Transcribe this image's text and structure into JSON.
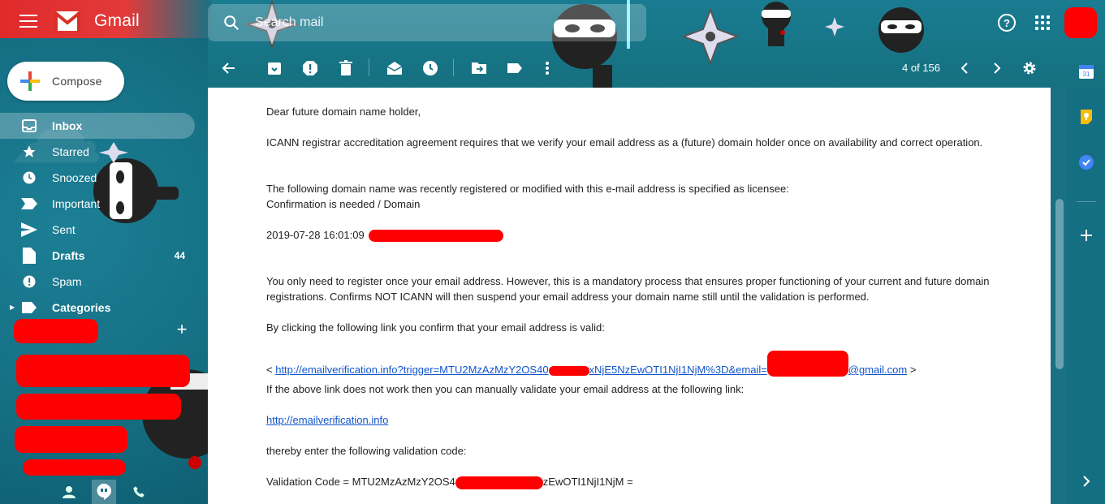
{
  "header": {
    "app_name": "Gmail",
    "search_placeholder": "Search mail"
  },
  "sidebar": {
    "compose_label": "Compose",
    "items": [
      {
        "label": "Inbox",
        "count": "",
        "active": true,
        "bold": true,
        "icon": "inbox-icon"
      },
      {
        "label": "Starred",
        "count": "",
        "icon": "star-icon"
      },
      {
        "label": "Snoozed",
        "count": "",
        "icon": "clock-icon"
      },
      {
        "label": "Important",
        "count": "",
        "icon": "important-icon"
      },
      {
        "label": "Sent",
        "count": "",
        "icon": "send-icon"
      },
      {
        "label": "Drafts",
        "count": "44",
        "bold": true,
        "icon": "draft-icon"
      },
      {
        "label": "Spam",
        "count": "",
        "icon": "spam-icon"
      },
      {
        "label": "Categories",
        "count": "",
        "bold": true,
        "icon": "label-icon"
      }
    ]
  },
  "toolbar": {
    "pager_text": "4 of 156"
  },
  "email": {
    "greeting": "Dear future domain name holder,",
    "p1": "ICANN registrar accreditation agreement requires that we verify your email address as a (future) domain holder once on availability and correct operation.",
    "p2_line1": "The following domain name was recently registered or modified with this e-mail address is specified as licensee:",
    "p2_line2": "Confirmation is needed / Domain",
    "timestamp": "2019-07-28 16:01:09",
    "p3": "You only need to register once your email address. However, this is a mandatory process that ensures proper functioning of your current and future domain registrations. Confirms NOT ICANN will then suspend your email address your domain name still until the validation is performed.",
    "p4": "By clicking the following link you confirm that your email address is valid:",
    "link_prefix": "< ",
    "link_part1": "http://emailverification.info?trigger=MTU2MzAzMzY2OS40",
    "link_part2": "xNjE5NzEwOTI1NjI1NjM%3D&email=",
    "link_part3": "@gmail.com",
    "link_suffix": " >",
    "p5": "If the above link does not work then you can manually validate your email address at the following link:",
    "link2": "http://emailverification.info",
    "p6": "thereby enter the following validation code:",
    "code_prefix": "Validation Code = MTU2MzAzMzY2OS4",
    "code_suffix": "zEwOTI1NjI1NjM ="
  },
  "colors": {
    "theme_teal": "#156f83",
    "theme_red": "#e02a2a",
    "redaction": "#ff0000",
    "link": "#1155cc"
  }
}
